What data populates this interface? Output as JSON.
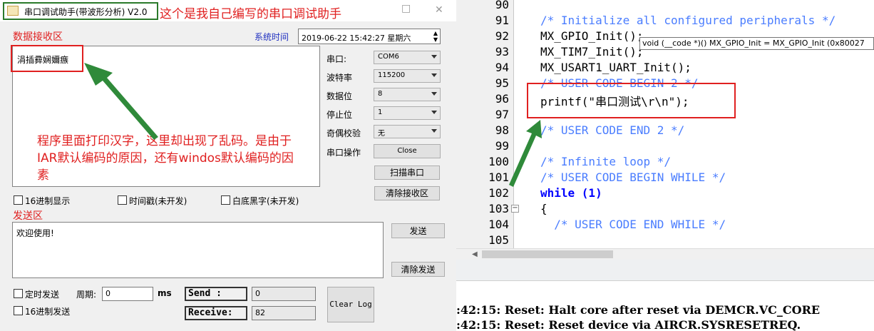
{
  "window": {
    "title": "串口调试助手(带波形分析)  V2.0",
    "minimize": "□",
    "title_annotation": "这个是我自己编写的串口调试助手"
  },
  "receive": {
    "label": "数据接收区",
    "time_label": "系统时间",
    "time_value": "2019-06-22 15:42:27 星期六",
    "content": "涓插彛娴嬭瘯",
    "annotation": "程序里面打印汉字，这里却出现了乱码。是由于IAR默认编码的原因，还有windos默认编码的因素"
  },
  "settings": {
    "port_label": "串口:",
    "port_value": "COM6",
    "baud_label": "波特率",
    "baud_value": "115200",
    "databits_label": "数据位",
    "databits_value": "8",
    "stopbits_label": "停止位",
    "stopbits_value": "1",
    "parity_label": "奇偶校验",
    "parity_value": "无",
    "op_label": "串口操作",
    "close_button": "Close",
    "scan_button": "扫描串口",
    "clear_receive_button": "清除接收区"
  },
  "options": {
    "hex_display": "16进制显示",
    "timestamp": "时间戳(未开发)",
    "white_bg": "白底黑字(未开发)"
  },
  "send": {
    "label": "发送区",
    "content": "欢迎使用!",
    "send_button": "发送",
    "clear_send_button": "清除发送",
    "timed_send": "定时发送",
    "period_label": "周期:",
    "period_value": "0",
    "period_unit": "ms",
    "hex_send": "16进制发送",
    "send_count_label": "Send :",
    "send_count": "0",
    "receive_count_label": "Receive:",
    "receive_count": "82",
    "clear_log_button": "Clear Log"
  },
  "editor": {
    "line_numbers": [
      "90",
      "91",
      "92",
      "93",
      "94",
      "95",
      "96",
      "97",
      "98",
      "99",
      "100",
      "101",
      "102",
      "103",
      "104",
      "105"
    ],
    "lines": [
      "",
      "/* Initialize all configured peripherals */",
      "MX_GPIO_Init();",
      "MX_TIM7_Init();",
      "MX_USART1_UART_Init();",
      "/* USER CODE BEGIN 2 */",
      "printf(\"串口测试\\r\\n\");",
      "",
      "/* USER CODE END 2 */",
      "",
      "/* Infinite loop */",
      "/* USER CODE BEGIN WHILE */",
      "while (1)",
      "{",
      "  /* USER CODE END WHILE */",
      ""
    ],
    "tooltip": "void (__code *)() MX_GPIO_Init = MX_GPIO_Init (0x80027",
    "fold_marker": "−"
  },
  "output": {
    "lines": [
      ":42:15: Reset: Halt core after reset via DEMCR.VC_CORE",
      ":42:15: Reset: Reset device via AIRCR.SYSRESETREQ."
    ]
  },
  "colors": {
    "annotation_red": "#e02020",
    "arrow_green": "#2f8a3a",
    "comment_blue": "#4a7dff",
    "keyword_blue": "#0000ff"
  }
}
